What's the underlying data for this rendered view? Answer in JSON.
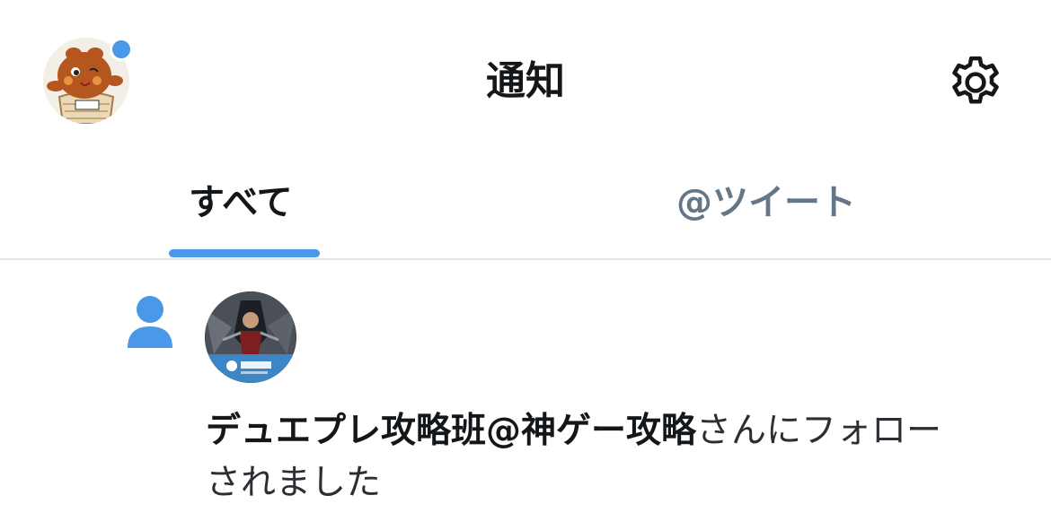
{
  "header": {
    "title": "通知",
    "profile_avatar_icon": "mascot-avatar",
    "unread_indicator_color": "#4a99e9",
    "settings_icon": "gear-icon"
  },
  "tabs": [
    {
      "label": "すべて",
      "selected": true
    },
    {
      "label": "@ツイート",
      "selected": false
    }
  ],
  "accent_color": "#4a99e9",
  "notifications": [
    {
      "type_icon": "person-follow-icon",
      "actor_avatar": "game-guide-avatar",
      "actor_name": "デュエプレ攻略班@神ゲー攻略",
      "action_line1": "さんにフォロー",
      "action_line2": "されました"
    }
  ]
}
